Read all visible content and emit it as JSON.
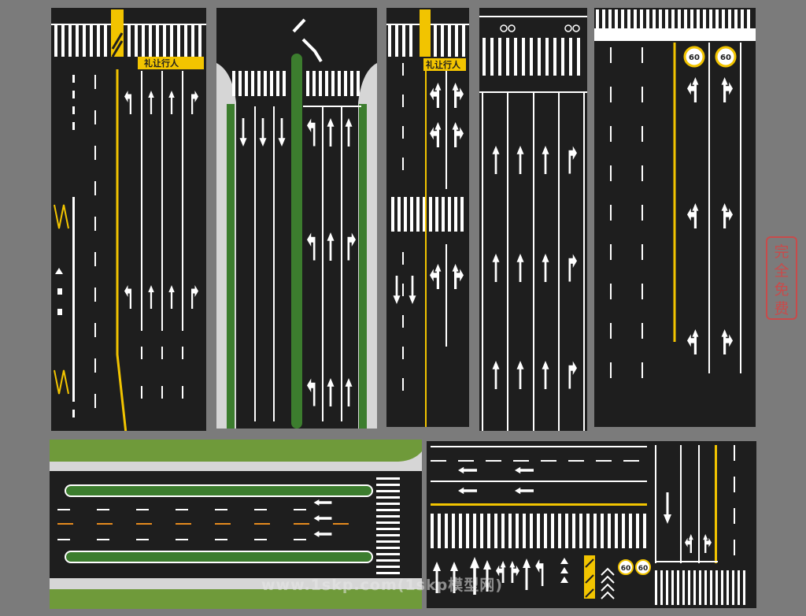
{
  "panels": {
    "p1": {
      "yield_sign": "礼让行人"
    },
    "p3": {
      "yield_sign": "礼让行人"
    },
    "p5": {
      "speed_limits": [
        "60",
        "60"
      ]
    },
    "p8": {
      "speed_limits": [
        "60",
        "60"
      ]
    }
  },
  "stamp": {
    "lines": [
      "完",
      "全",
      "免",
      "费"
    ]
  },
  "watermark": {
    "text": "www.1skp.com(1skp模型网)"
  },
  "colors": {
    "asphalt": "#1e1e1e",
    "marking_white": "#ffffff",
    "marking_yellow": "#f2c400",
    "grass": "#6f9a3a",
    "background": "#7b7b7b"
  }
}
